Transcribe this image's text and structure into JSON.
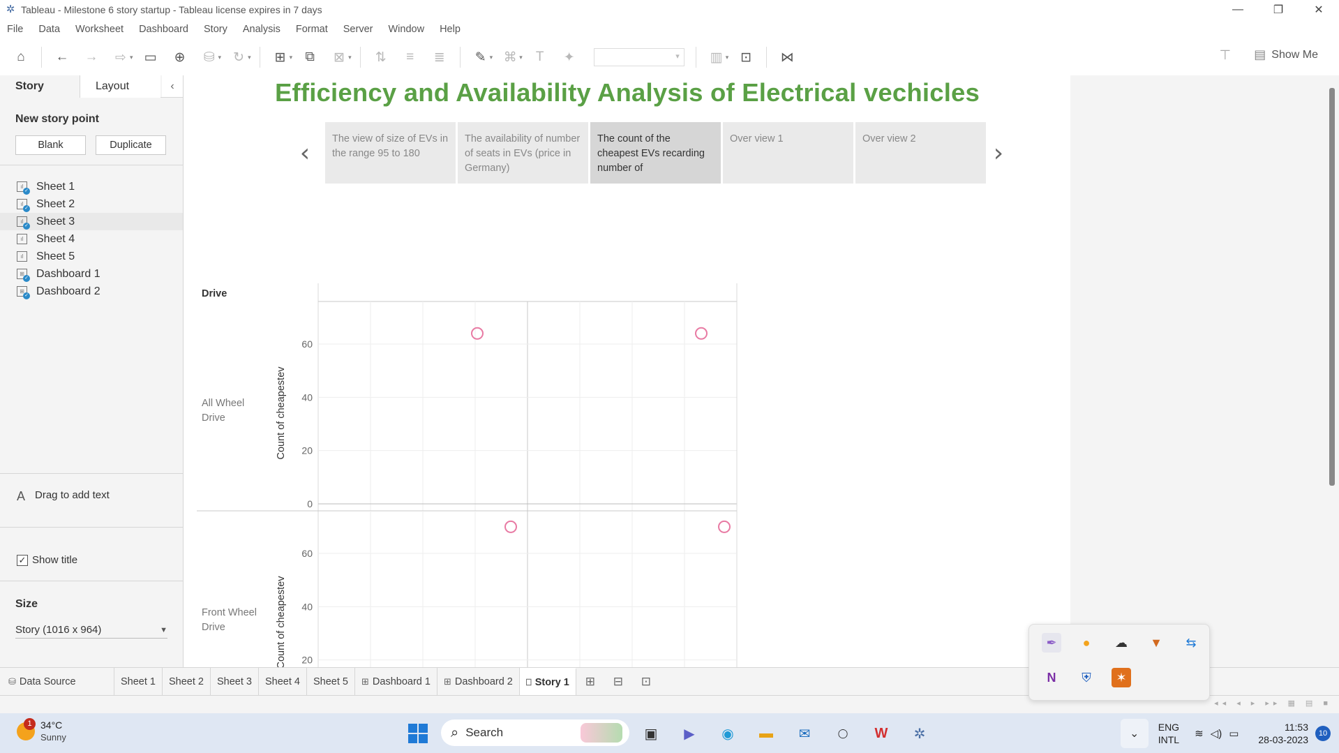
{
  "window": {
    "title": "Tableau - Milestone 6 story startup - Tableau license expires in 7 days",
    "controls": [
      "minimize",
      "restore",
      "close"
    ]
  },
  "menu": [
    "File",
    "Data",
    "Worksheet",
    "Dashboard",
    "Story",
    "Analysis",
    "Format",
    "Server",
    "Window",
    "Help"
  ],
  "toolbar": {
    "show_me": "Show Me"
  },
  "left_panel": {
    "tabs": {
      "story": "Story",
      "layout": "Layout"
    },
    "new_story_point": "New story point",
    "blank_button": "Blank",
    "duplicate_button": "Duplicate",
    "sheets": [
      {
        "label": "Sheet 1",
        "kind": "sheet",
        "in_use": true
      },
      {
        "label": "Sheet 2",
        "kind": "sheet",
        "in_use": true
      },
      {
        "label": "Sheet 3",
        "kind": "sheet",
        "in_use": true
      },
      {
        "label": "Sheet 4",
        "kind": "sheet",
        "in_use": false
      },
      {
        "label": "Sheet 5",
        "kind": "sheet",
        "in_use": false
      },
      {
        "label": "Dashboard 1",
        "kind": "dashboard",
        "in_use": true
      },
      {
        "label": "Dashboard 2",
        "kind": "dashboard",
        "in_use": true
      }
    ],
    "drag_text": "Drag to add text",
    "show_title": "Show title",
    "show_title_checked": true,
    "size_heading": "Size",
    "size_value": "Story (1016 x 964)"
  },
  "story": {
    "title": "Efficiency and Availability Analysis of Electrical vechicles",
    "title_color": "#5aa045",
    "points": [
      {
        "caption": "The view of size of EVs in the range 95 to 180",
        "active": false
      },
      {
        "caption": "The availability of number of seats in EVs (price in Germany)",
        "active": false
      },
      {
        "caption": "The count of the cheapest EVs recarding number of",
        "active": true
      },
      {
        "caption": "Over view 1",
        "active": false
      },
      {
        "caption": "Over view 2",
        "active": false
      }
    ]
  },
  "chart_data": {
    "type": "scatter",
    "row_header": "Drive",
    "rows": [
      "All Wheel Drive",
      "Front Wheel Drive"
    ],
    "ylabel": "Count of cheapestev",
    "yticks": [
      0,
      20,
      40,
      60
    ],
    "ylim": [
      0,
      76
    ],
    "columns": 2,
    "marker_color": "#e87aa3",
    "points": [
      {
        "row": "All Wheel Drive",
        "col": 0,
        "x_frac": 0.76,
        "y": 64
      },
      {
        "row": "All Wheel Drive",
        "col": 1,
        "x_frac": 0.83,
        "y": 64
      },
      {
        "row": "Front Wheel Drive",
        "col": 0,
        "x_frac": 0.92,
        "y": 70
      },
      {
        "row": "Front Wheel Drive",
        "col": 1,
        "x_frac": 0.94,
        "y": 70
      }
    ]
  },
  "bottom_tabs": {
    "data_source": "Data Source",
    "tabs": [
      {
        "label": "Sheet 1",
        "icon": ""
      },
      {
        "label": "Sheet 2",
        "icon": ""
      },
      {
        "label": "Sheet 3",
        "icon": ""
      },
      {
        "label": "Sheet 4",
        "icon": ""
      },
      {
        "label": "Sheet 5",
        "icon": ""
      },
      {
        "label": "Dashboard 1",
        "icon": "dashboard-icon"
      },
      {
        "label": "Dashboard 2",
        "icon": "dashboard-icon"
      },
      {
        "label": "Story 1",
        "icon": "story-icon",
        "active": true
      }
    ]
  },
  "taskbar": {
    "weather_temp": "34°C",
    "weather_cond": "Sunny",
    "weather_badge": "1",
    "search_label": "Search",
    "lang_1": "ENG",
    "lang_2": "INTL",
    "time": "11:53",
    "date": "28-03-2023",
    "notifications": "10"
  }
}
